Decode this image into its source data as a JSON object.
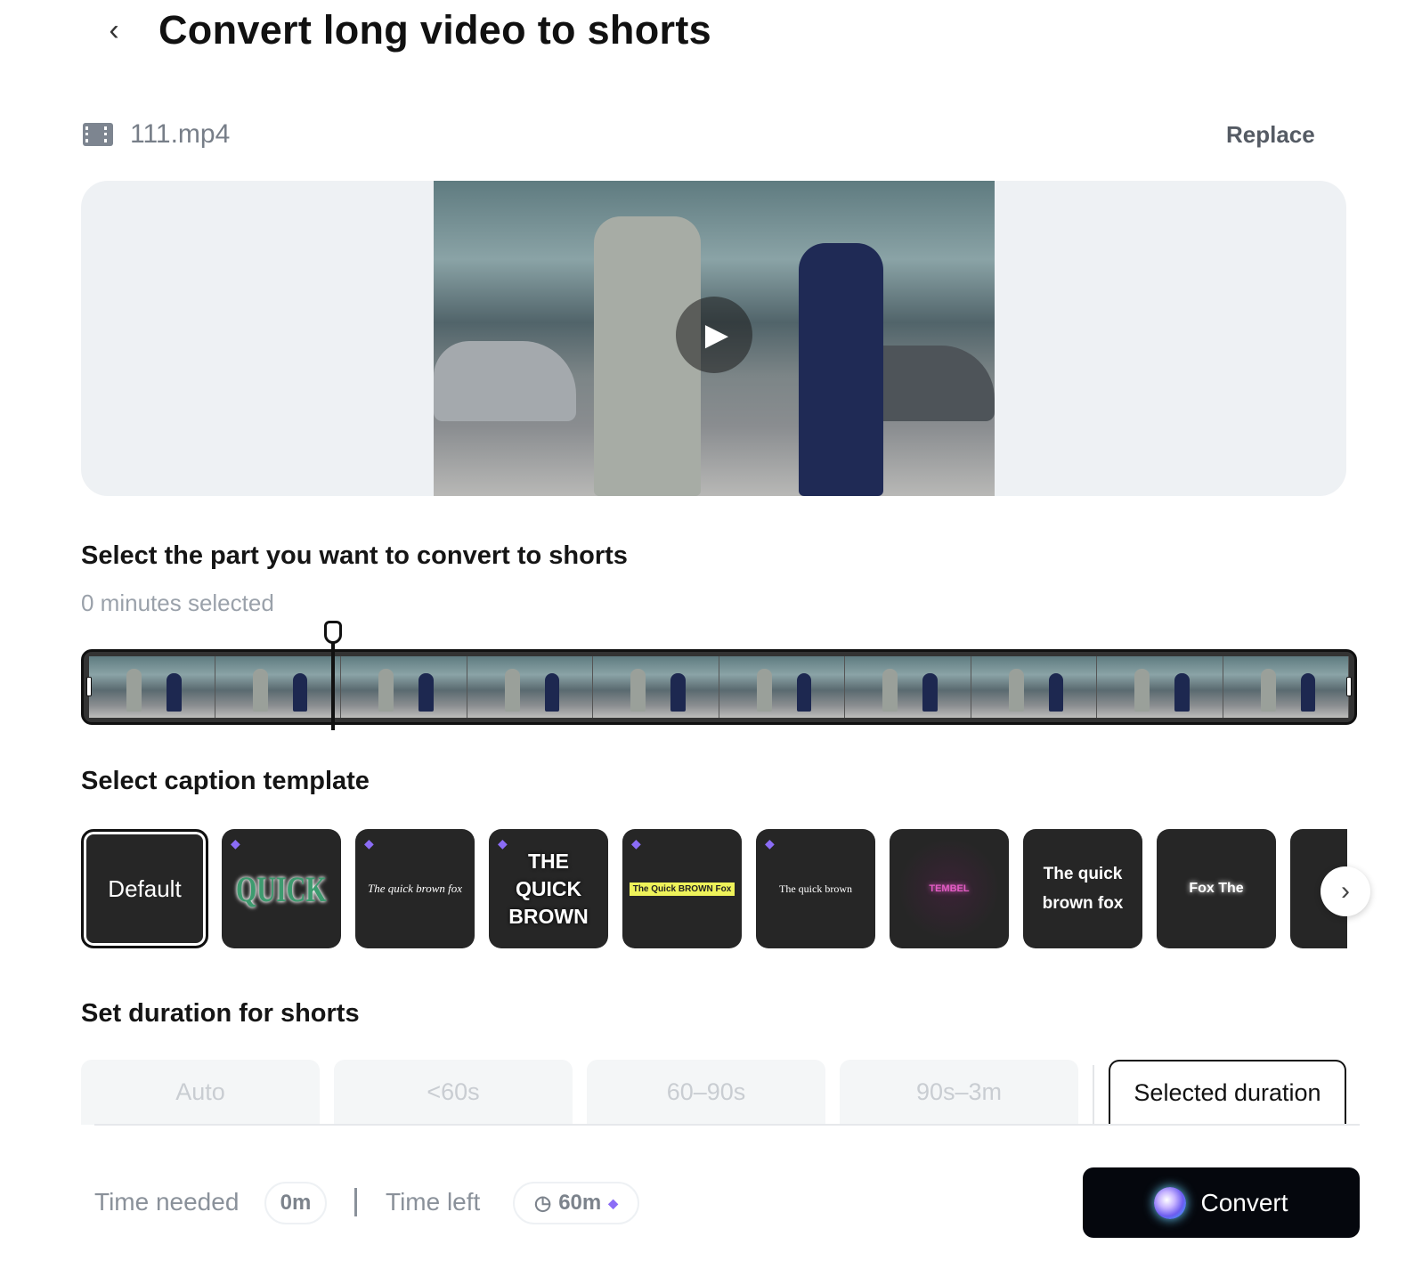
{
  "header": {
    "title": "Convert long video to shorts"
  },
  "file": {
    "name": "111.mp4",
    "replace_label": "Replace"
  },
  "selection": {
    "heading": "Select the part you want to convert to shorts",
    "selected_text": "0 minutes selected",
    "filmstrip_frames": 10
  },
  "captions": {
    "heading": "Select caption template",
    "templates": [
      {
        "label": "Default",
        "premium": false
      },
      {
        "label": "QUICK",
        "premium": true
      },
      {
        "label": "The quick brown fox",
        "premium": true
      },
      {
        "label": "THE QUICK BROWN",
        "premium": true
      },
      {
        "label": "The Quick BROWN Fox",
        "premium": true
      },
      {
        "label": "The quick brown",
        "premium": true
      },
      {
        "label": "TEMBEL",
        "premium": false
      },
      {
        "label": "The quick brown fox",
        "premium": false
      },
      {
        "label": "Fox The",
        "premium": false
      }
    ]
  },
  "duration": {
    "heading": "Set duration for shorts",
    "options": [
      "Auto",
      "<60s",
      "60–90s",
      "90s–3m"
    ],
    "selected_label": "Selected duration"
  },
  "footer": {
    "time_needed_label": "Time needed",
    "time_needed": "0m",
    "time_left_label": "Time left",
    "time_left": "60m",
    "convert_label": "Convert"
  },
  "colors": {
    "accent": "#8b6cf6",
    "dark": "#262626"
  }
}
